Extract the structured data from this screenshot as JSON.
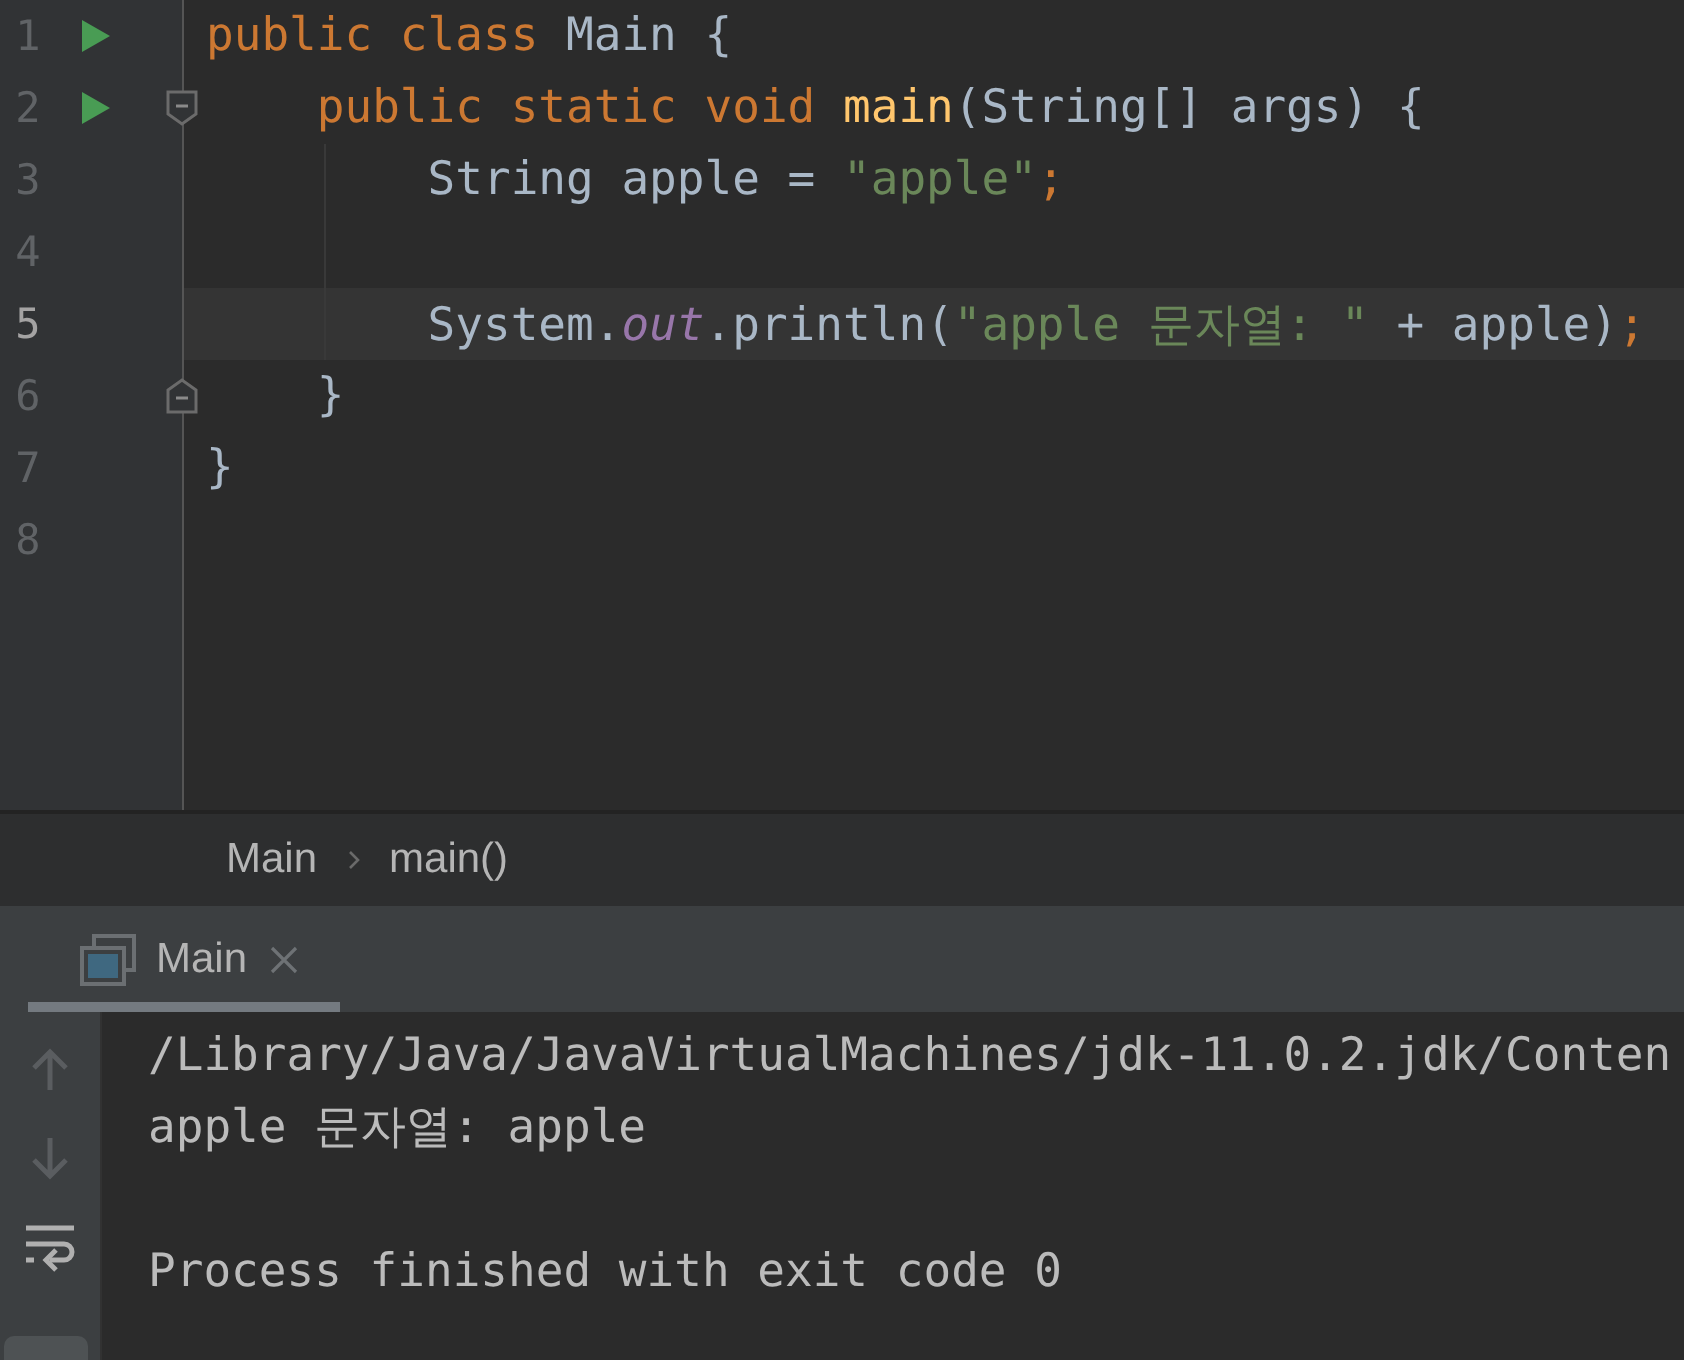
{
  "editor": {
    "lines": [
      {
        "number": "1",
        "run": true,
        "fold_start": false,
        "fold_end": false,
        "current": false,
        "tokens": [
          {
            "kind": "keyword",
            "text": "public class "
          },
          {
            "kind": "plain",
            "text": "Main {"
          }
        ]
      },
      {
        "number": "2",
        "run": true,
        "fold_start": true,
        "fold_end": false,
        "current": false,
        "tokens": [
          {
            "kind": "keyword",
            "text": "    public static void "
          },
          {
            "kind": "method",
            "text": "main"
          },
          {
            "kind": "plain",
            "text": "(String[] args) {"
          }
        ]
      },
      {
        "number": "3",
        "run": false,
        "fold_start": false,
        "fold_end": false,
        "current": false,
        "tokens": [
          {
            "kind": "plain",
            "text": "        String apple = "
          },
          {
            "kind": "string",
            "text": "\"apple\""
          },
          {
            "kind": "keyword",
            "text": ";"
          }
        ]
      },
      {
        "number": "4",
        "run": false,
        "fold_start": false,
        "fold_end": false,
        "current": false
      },
      {
        "number": "5",
        "run": false,
        "fold_start": false,
        "fold_end": false,
        "current": true,
        "tokens": [
          {
            "kind": "plain",
            "text": "        System."
          },
          {
            "kind": "field",
            "text": "out"
          },
          {
            "kind": "plain",
            "text": ".println("
          },
          {
            "kind": "string",
            "text": "\"apple 문자열: \""
          },
          {
            "kind": "plain",
            "text": " + apple)"
          },
          {
            "kind": "keyword",
            "text": ";"
          }
        ]
      },
      {
        "number": "6",
        "run": false,
        "fold_start": false,
        "fold_end": true,
        "current": false,
        "tokens": [
          {
            "kind": "plain",
            "text": "    }"
          }
        ]
      },
      {
        "number": "7",
        "run": false,
        "fold_start": false,
        "fold_end": false,
        "current": false,
        "tokens": [
          {
            "kind": "plain",
            "text": "}"
          }
        ]
      },
      {
        "number": "8",
        "run": false,
        "fold_start": false,
        "fold_end": false,
        "current": false
      }
    ]
  },
  "breadcrumbs": [
    "Main",
    "main()"
  ],
  "run_tabs": [
    {
      "label": "Main",
      "selected": true
    }
  ],
  "console": {
    "lines": [
      "/Library/Java/JavaVirtualMachines/jdk-11.0.2.jdk/Conten",
      "apple 문자열: apple"
    ],
    "exit_message": "Process finished with exit code 0"
  }
}
